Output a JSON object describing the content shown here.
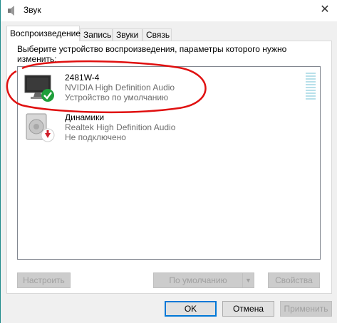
{
  "window": {
    "title": "Звук",
    "close_glyph": "✕"
  },
  "tabs": [
    {
      "label": "Воспроизведение",
      "active": true
    },
    {
      "label": "Запись",
      "active": false
    },
    {
      "label": "Звуки",
      "active": false
    },
    {
      "label": "Связь",
      "active": false
    }
  ],
  "instruction": "Выберите устройство воспроизведения, параметры которого нужно изменить:",
  "devices": [
    {
      "name": "2481W-4",
      "driver": "NVIDIA High Definition Audio",
      "status": "Устройство по умолчанию",
      "icon": "monitor-icon",
      "badge": "default-check-icon"
    },
    {
      "name": "Динамики",
      "driver": "Realtek High Definition Audio",
      "status": "Не подключено",
      "icon": "speaker-icon",
      "badge": "disconnected-arrow-icon"
    }
  ],
  "buttons": {
    "configure": "Настроить",
    "set_default": "По умолчанию",
    "properties": "Свойства",
    "ok": "OK",
    "cancel": "Отмена",
    "apply": "Применить"
  },
  "colors": {
    "annotation_red": "#e01010",
    "check_green": "#1e9e3a",
    "disconnected_red": "#d01f2a"
  }
}
